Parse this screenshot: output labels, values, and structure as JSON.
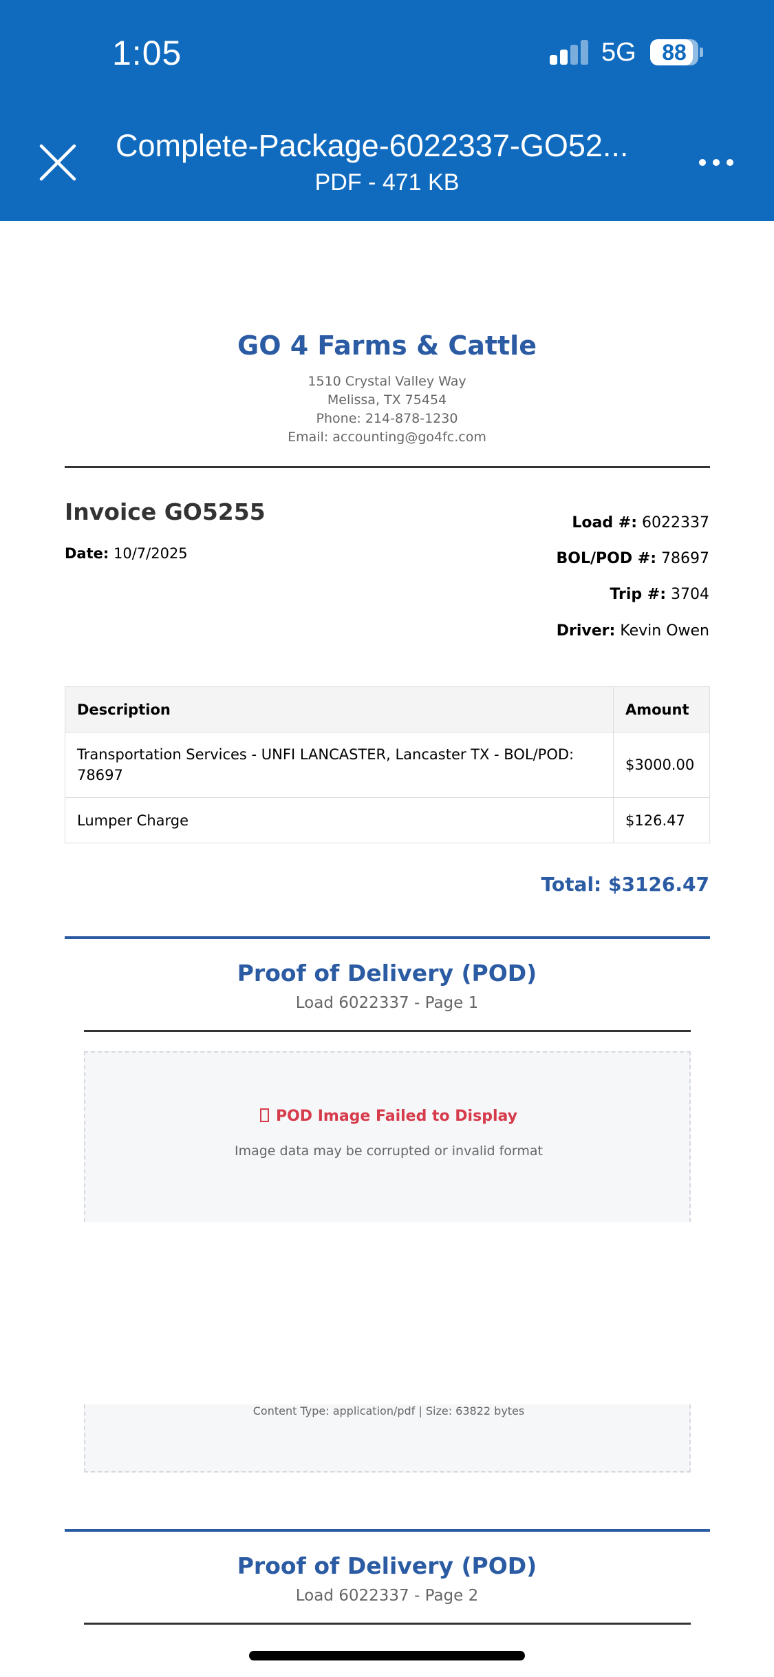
{
  "status_bar": {
    "time": "1:05",
    "network": "5G",
    "battery_level": "88",
    "signal_bars_active": 2,
    "signal_bars_total": 4
  },
  "header": {
    "close_icon": "close-icon",
    "file_name": "Complete-Package-6022337-GO52...",
    "file_info": "PDF - 471 KB",
    "more_icon": "more-horizontal-icon",
    "background_color": "#106bbf"
  },
  "document": {
    "company": {
      "name": "GO 4 Farms & Cattle",
      "address1": "1510 Crystal Valley Way",
      "address2": "Melissa, TX 75454",
      "phone": "Phone: 214-878-1230",
      "email": "Email: accounting@go4fc.com"
    },
    "invoice": {
      "title": "Invoice GO5255",
      "date_label": "Date:",
      "date_value": "10/7/2025",
      "load_label": "Load #:",
      "load_value": "6022337",
      "bol_label": "BOL/POD #:",
      "bol_value": "78697",
      "trip_label": "Trip #:",
      "trip_value": "3704",
      "driver_label": "Driver:",
      "driver_value": "Kevin Owen"
    },
    "table": {
      "headers": [
        "Description",
        "Amount"
      ],
      "rows": [
        [
          "Transportation Services - UNFI LANCASTER, Lancaster TX - BOL/POD: 78697",
          "$3000.00"
        ],
        [
          "Lumper Charge",
          "$126.47"
        ]
      ]
    },
    "total": "Total: $3126.47",
    "pod_pages": [
      {
        "title": "Proof of Delivery (POD)",
        "subtitle": "Load 6022337 - Page 1",
        "error_title": "POD Image Failed to Display",
        "error_note": "Image data may be corrupted or invalid format",
        "meta": "Content Type: application/pdf | Size: 63822 bytes"
      },
      {
        "title": "Proof of Delivery (POD)",
        "subtitle": "Load 6022337 - Page 2"
      }
    ],
    "accent_color": "#2b5ba3",
    "error_color": "#d63b4b"
  }
}
